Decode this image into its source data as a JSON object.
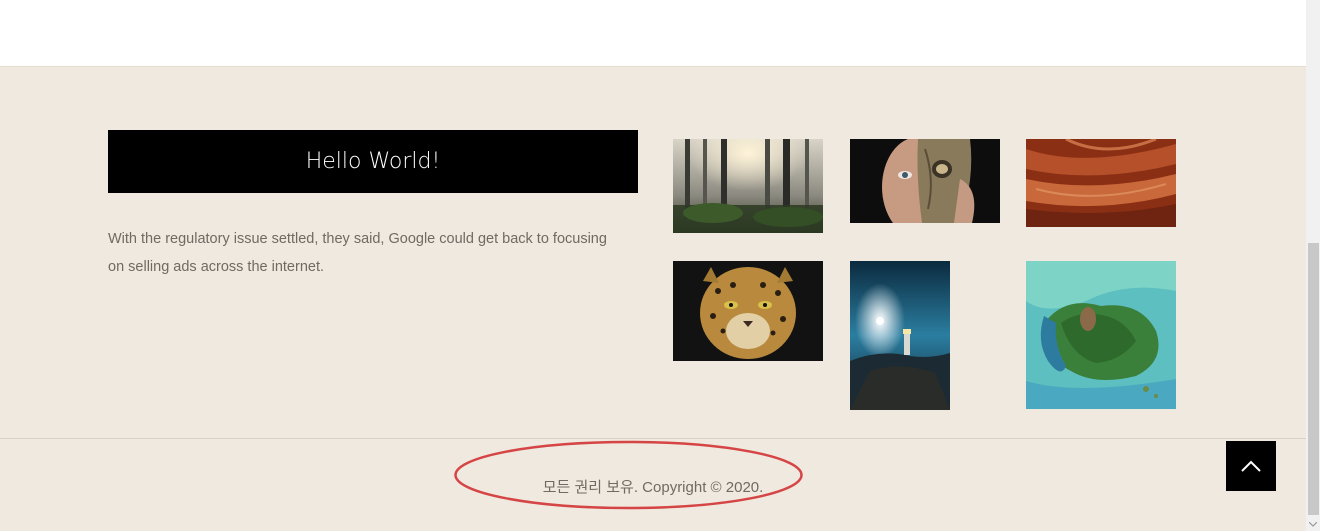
{
  "widget": {
    "title": "Hello World!",
    "description": "With the regulatory issue settled, they said, Google could get back to focusing on selling ads across the internet."
  },
  "gallery": {
    "items": [
      {
        "icon": "forest-photo"
      },
      {
        "icon": "butterfly-face-photo"
      },
      {
        "icon": "canyon-photo"
      },
      {
        "icon": "leopard-photo"
      },
      {
        "icon": "lighthouse-photo"
      },
      {
        "icon": "island-aerial-photo"
      }
    ]
  },
  "footer": {
    "copyright": "모든 권리 보유. Copyright © 2020."
  },
  "back_to_top": {
    "icon": "chevron-up-icon"
  },
  "colors": {
    "footer_bg": "#efe9df",
    "banner_bg": "#000000",
    "annotation": "#d64545"
  }
}
